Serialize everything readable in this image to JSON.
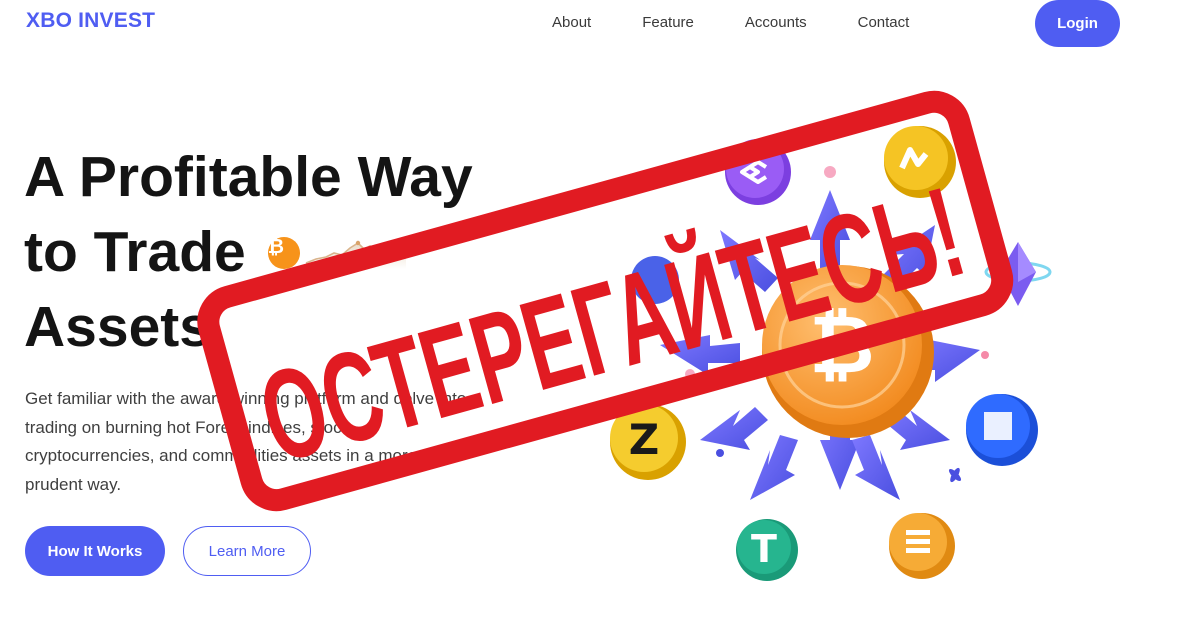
{
  "brand": {
    "name": "XBO INVEST"
  },
  "nav": {
    "items": [
      {
        "label": "About"
      },
      {
        "label": "Feature"
      },
      {
        "label": "Accounts"
      },
      {
        "label": "Contact"
      }
    ],
    "login_label": "Login"
  },
  "hero": {
    "title_line1": "A Profitable Way",
    "title_line2": "to Trade",
    "title_line3": "Assets",
    "btc_symbol": "₿",
    "description": "Get familiar with the award-winning platform and delve into trading on burning hot Forex, indices, stock, cryptocurrencies, and commodities assets in a more prudent way.",
    "primary_button": "How It Works",
    "secondary_button": "Learn More"
  },
  "illustration": {
    "main_coin_symbol": "₿",
    "coin_icons": [
      "polygon-coin-icon",
      "dogecoin-coin-icon",
      "ethereum-icon",
      "bitcoin-coin-icon",
      "zcash-coin-icon",
      "binance-coin-icon",
      "tether-coin-icon",
      "generic-orange-coin-icon"
    ]
  },
  "stamp": {
    "text": "ОСТЕРЕГАЙТЕСЬ!",
    "color": "#e11b22"
  },
  "colors": {
    "accent": "#4f5df2",
    "bitcoin": "#f7931a"
  }
}
